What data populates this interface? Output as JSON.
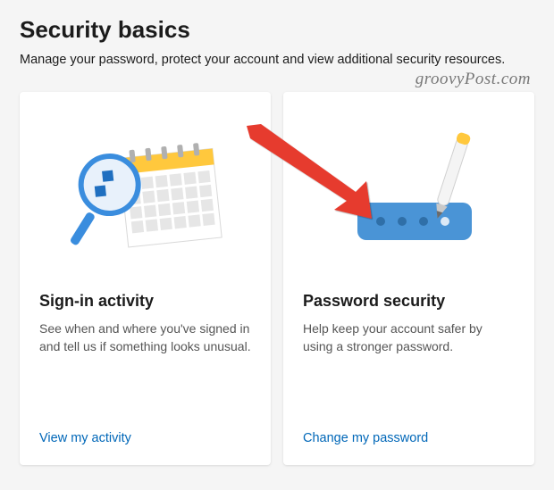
{
  "page": {
    "title": "Security basics",
    "subtitle": "Manage your password, protect your account and view additional security resources."
  },
  "watermark": "groovyPost.com",
  "cards": [
    {
      "heading": "Sign-in activity",
      "description": "See when and where you've signed in and tell us if something looks unusual.",
      "link_label": "View my activity"
    },
    {
      "heading": "Password security",
      "description": "Help keep your account safer by using a stronger password.",
      "link_label": "Change my password"
    }
  ]
}
